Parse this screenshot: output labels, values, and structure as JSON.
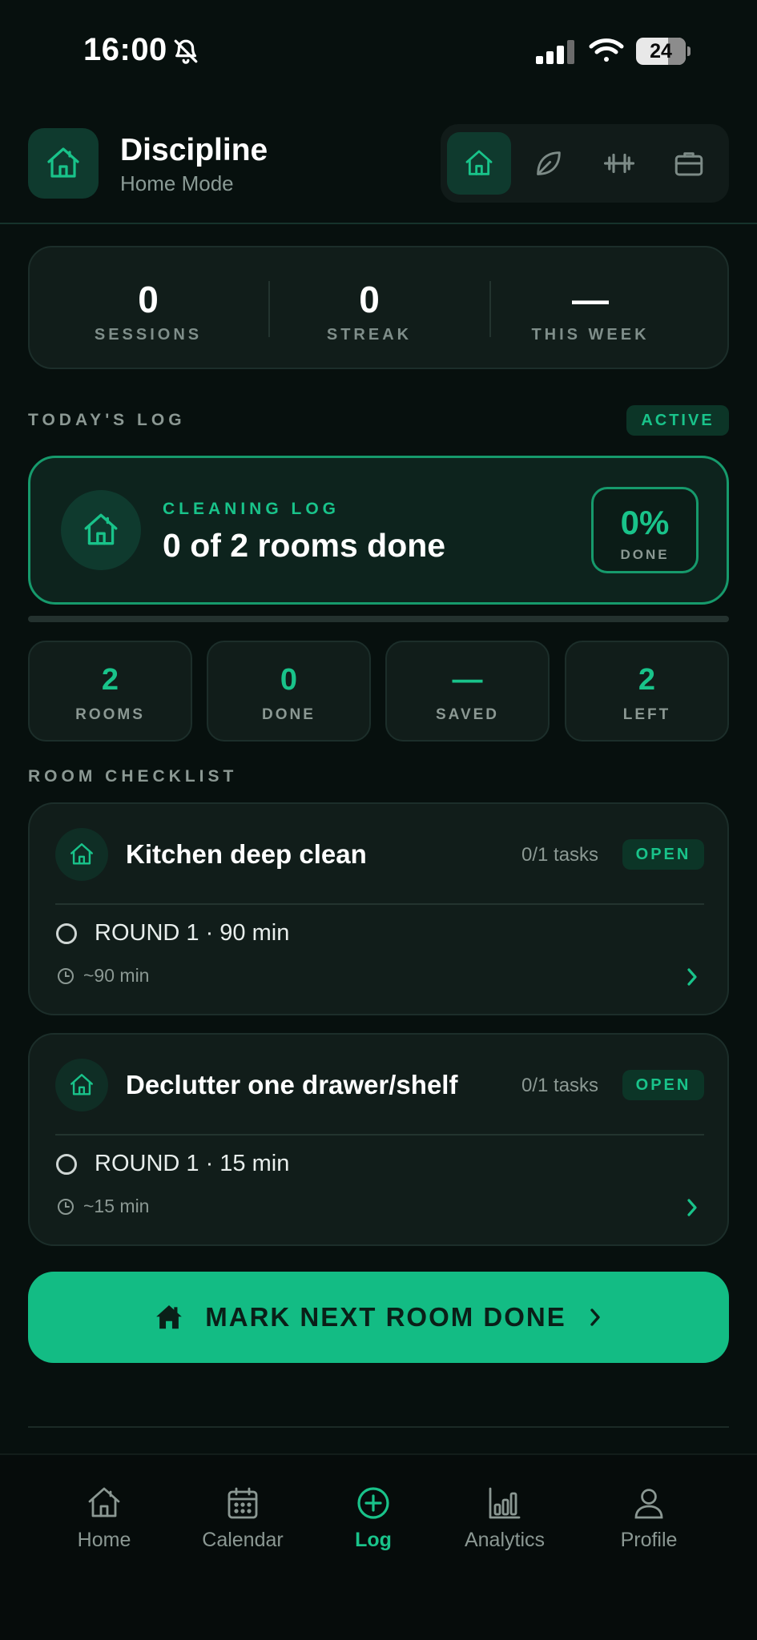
{
  "status_bar": {
    "time": "16:00",
    "battery": "24"
  },
  "header": {
    "title": "Discipline",
    "subtitle": "Home Mode",
    "modes": [
      "home-icon",
      "leaf-icon",
      "dumbbell-icon",
      "briefcase-icon"
    ],
    "active_mode": "home"
  },
  "stats": [
    {
      "value": "0",
      "label": "SESSIONS"
    },
    {
      "value": "0",
      "label": "STREAK"
    },
    {
      "value": "—",
      "label": "THIS WEEK"
    }
  ],
  "todays_log": {
    "title": "TODAY'S LOG",
    "badge": "ACTIVE"
  },
  "log_card": {
    "label": "CLEANING LOG",
    "title": "0 of 2 rooms done",
    "percent": "0%",
    "percent_label": "DONE",
    "progress": 0
  },
  "mini_stats": [
    {
      "value": "2",
      "label": "ROOMS"
    },
    {
      "value": "0",
      "label": "DONE"
    },
    {
      "value": "—",
      "label": "SAVED"
    },
    {
      "value": "2",
      "label": "LEFT"
    }
  ],
  "checklist": {
    "title": "ROOM CHECKLIST",
    "rooms": [
      {
        "title": "Kitchen deep clean",
        "tasks": "0/1 tasks",
        "status": "OPEN",
        "round": "ROUND 1 · 90 min",
        "duration": "~90 min"
      },
      {
        "title": "Declutter one drawer/shelf",
        "tasks": "0/1 tasks",
        "status": "OPEN",
        "round": "ROUND 1 · 15 min",
        "duration": "~15 min"
      }
    ]
  },
  "cta": {
    "label": "MARK NEXT ROOM DONE"
  },
  "nav": {
    "items": [
      {
        "label": "Home",
        "icon": "home-icon"
      },
      {
        "label": "Calendar",
        "icon": "calendar-icon"
      },
      {
        "label": "Log",
        "icon": "plus-circle-icon"
      },
      {
        "label": "Analytics",
        "icon": "bar-chart-icon"
      },
      {
        "label": "Profile",
        "icon": "person-icon"
      }
    ],
    "active": "Log"
  },
  "colors": {
    "accent": "#19c38a",
    "cta": "#13bc84",
    "background": "#07100e",
    "card": "#111d1a"
  }
}
